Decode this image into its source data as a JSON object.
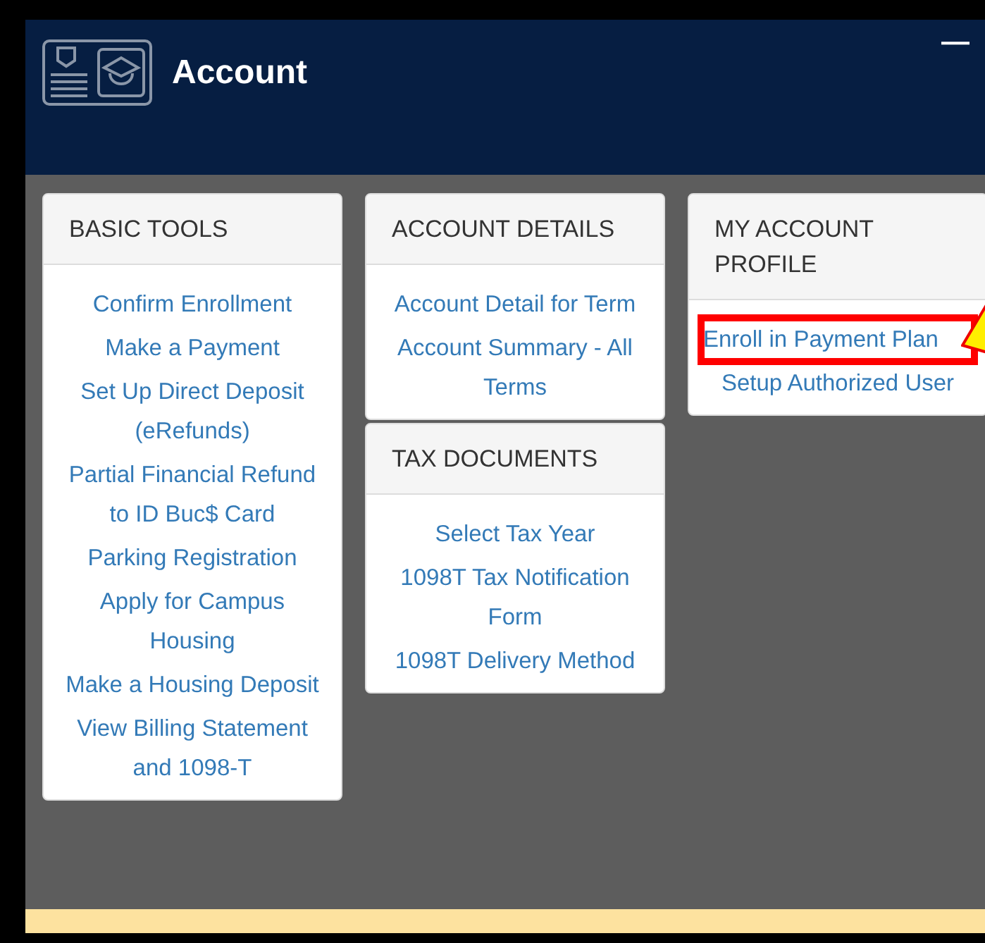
{
  "header": {
    "title": "Account",
    "minimize_button": "—"
  },
  "columns": [
    {
      "cards": [
        {
          "title": "BASIC TOOLS",
          "links": [
            {
              "label": "Confirm Enrollment",
              "highlighted": false
            },
            {
              "label": "Make a Payment",
              "highlighted": false
            },
            {
              "label": "Set Up Direct Deposit (eRefunds)",
              "highlighted": false
            },
            {
              "label": "Partial Financial Refund to ID Buc$ Card",
              "highlighted": false
            },
            {
              "label": "Parking Registration",
              "highlighted": false
            },
            {
              "label": "Apply for Campus Housing",
              "highlighted": false
            },
            {
              "label": "Make a Housing Deposit",
              "highlighted": false
            },
            {
              "label": "View Billing Statement and 1098-T",
              "highlighted": false
            }
          ]
        }
      ]
    },
    {
      "cards": [
        {
          "title": "ACCOUNT DETAILS",
          "links": [
            {
              "label": "Account Detail for Term",
              "highlighted": false
            },
            {
              "label": "Account Summary - All Terms",
              "highlighted": false
            }
          ]
        },
        {
          "title": "TAX DOCUMENTS",
          "links": [
            {
              "label": "Select Tax Year",
              "highlighted": false
            },
            {
              "label": "1098T Tax Notification Form",
              "highlighted": false
            },
            {
              "label": "1098T Delivery Method",
              "highlighted": false
            }
          ]
        }
      ]
    },
    {
      "cards": [
        {
          "title": "MY ACCOUNT PROFILE",
          "links": [
            {
              "label": "Enroll in Payment Plan",
              "highlighted": true
            },
            {
              "label": "Setup Authorized User",
              "highlighted": false
            }
          ]
        }
      ]
    }
  ]
}
